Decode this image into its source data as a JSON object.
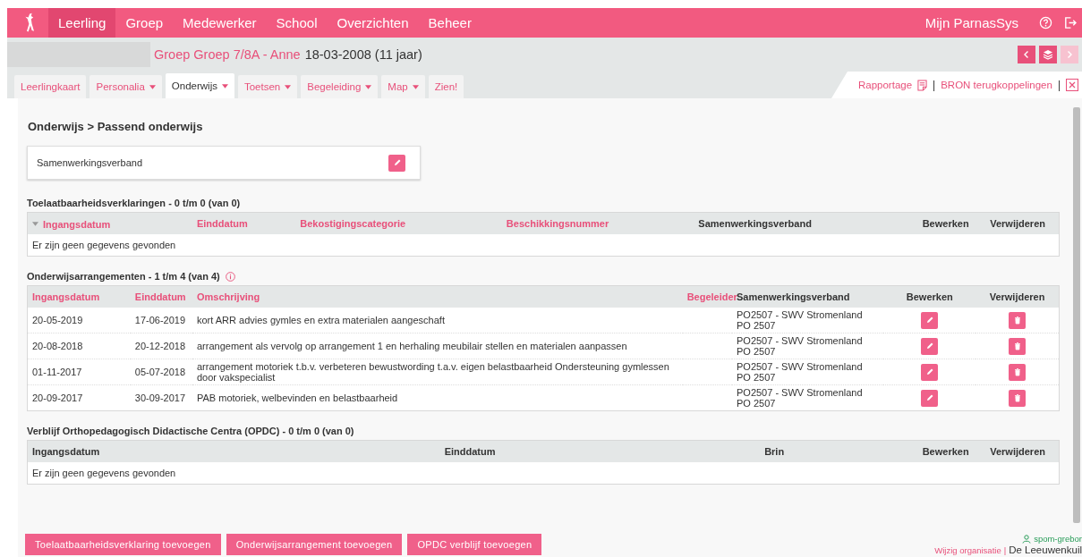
{
  "nav": {
    "items": [
      {
        "label": "Leerling",
        "selected": true
      },
      {
        "label": "Groep",
        "selected": false
      },
      {
        "label": "Medewerker",
        "selected": false
      },
      {
        "label": "School",
        "selected": false
      },
      {
        "label": "Overzichten",
        "selected": false
      },
      {
        "label": "Beheer",
        "selected": false
      }
    ],
    "user_menu": "Mijn ParnasSys"
  },
  "header": {
    "group": "Groep Groep 7/8A - Anne",
    "birth": "18-03-2008 (11 jaar)",
    "buttons": [
      {
        "kind": "prev",
        "disabled": false
      },
      {
        "kind": "stack",
        "disabled": false
      },
      {
        "kind": "next",
        "disabled": true
      }
    ]
  },
  "tabs": [
    {
      "label": "Leerlingkaart",
      "dropdown": false,
      "selected": false
    },
    {
      "label": "Personalia",
      "dropdown": true,
      "selected": false
    },
    {
      "label": "Onderwijs",
      "dropdown": true,
      "selected": true
    },
    {
      "label": "Toetsen",
      "dropdown": true,
      "selected": false
    },
    {
      "label": "Begeleiding",
      "dropdown": true,
      "selected": false
    },
    {
      "label": "Map",
      "dropdown": true,
      "selected": false
    },
    {
      "label": "Zien!",
      "dropdown": false,
      "selected": false
    }
  ],
  "tab_links": {
    "report": "Rapportage",
    "separator_1": "|",
    "bron": "BRON terugkoppelingen",
    "separator_2": "|"
  },
  "page_title": "Onderwijs > Passend onderwijs",
  "partnership_card": {
    "label": "Samenwerkingsverband"
  },
  "tables": [
    {
      "title": "Toelaatbaarheidsverklaringen - 0 t/m 0 (van 0)",
      "info": false,
      "columns": [
        {
          "label": "Ingangsdatum",
          "kind": "text",
          "sortable": true,
          "sorted": true
        },
        {
          "label": "Einddatum",
          "kind": "text",
          "sortable": true,
          "sorted": false
        },
        {
          "label": "Bekostigingscategorie",
          "kind": "text",
          "sortable": true,
          "sorted": false
        },
        {
          "label": "Beschikkingsnummer",
          "kind": "text",
          "sortable": true,
          "sorted": false
        },
        {
          "label": "Samenwerkingsverband",
          "kind": "text",
          "sortable": false,
          "sorted": false
        },
        {
          "label": "Bewerken",
          "kind": "edit",
          "sortable": false,
          "sorted": false
        },
        {
          "label": "Verwijderen",
          "kind": "delete",
          "sortable": false,
          "sorted": false
        }
      ],
      "empty_text": "Er zijn geen gegevens gevonden"
    },
    {
      "title": "Onderwijsarrangementen - 1 t/m 4 (van 4)",
      "info": true,
      "columns": [
        {
          "label": "Ingangsdatum",
          "kind": "text",
          "sortable": true,
          "sorted": false
        },
        {
          "label": "Einddatum",
          "kind": "text",
          "sortable": true,
          "sorted": false
        },
        {
          "label": "Omschrijving",
          "kind": "text",
          "sortable": true,
          "sorted": false
        },
        {
          "label": "Begeleider",
          "kind": "empty",
          "sortable": true,
          "sorted": false
        },
        {
          "label": "Samenwerkingsverband",
          "kind": "text",
          "sortable": false,
          "sorted": false
        },
        {
          "label": "Bewerken",
          "kind": "edit",
          "sortable": false,
          "sorted": false
        },
        {
          "label": "Verwijderen",
          "kind": "delete",
          "sortable": false,
          "sorted": false
        }
      ],
      "rows": [
        {
          "cells": [
            "20-05-2019",
            "17-06-2019",
            "kort ARR advies gymles en extra materialen aangeschaft",
            "PO2507 - SWV Stromenland PO 2507"
          ]
        },
        {
          "cells": [
            "20-08-2018",
            "20-12-2018",
            "arrangement als vervolg op arrangement 1 en herhaling meubilair stellen en materialen aanpassen",
            "PO2507 - SWV Stromenland PO 2507"
          ]
        },
        {
          "cells": [
            "01-11-2017",
            "05-07-2018",
            "arrangement motoriek t.b.v. verbeteren bewustwording t.a.v. eigen belastbaarheid Ondersteuning gymlessen door vakspecialist",
            "PO2507 - SWV Stromenland PO 2507"
          ]
        },
        {
          "cells": [
            "20-09-2017",
            "30-09-2017",
            "PAB motoriek, welbevinden en belastbaarheid",
            "PO2507 - SWV Stromenland PO 2507"
          ]
        }
      ]
    },
    {
      "title": "Verblijf Orthopedagogisch Didactische Centra (OPDC) - 0 t/m 0 (van 0)",
      "info": false,
      "columns": [
        {
          "label": "Ingangsdatum",
          "kind": "text",
          "sortable": false,
          "sorted": false
        },
        {
          "label": "Einddatum",
          "kind": "text",
          "sortable": false,
          "sorted": false
        },
        {
          "label": "Brin",
          "kind": "text",
          "sortable": false,
          "sorted": false
        },
        {
          "label": "Bewerken",
          "kind": "edit",
          "sortable": false,
          "sorted": false
        },
        {
          "label": "Verwijderen",
          "kind": "delete",
          "sortable": false,
          "sorted": false
        }
      ],
      "empty_text": "Er zijn geen gegevens gevonden"
    }
  ],
  "footer": {
    "buttons": [
      "Toelaatbaarheidsverklaring toevoegen",
      "Onderwijsarrangement toevoegen",
      "OPDC verblijf toevoegen"
    ],
    "user": "spom-grebor",
    "change_org": "Wijzig organisatie",
    "separator": "|",
    "organisation": "De Leeuwenkuil"
  }
}
